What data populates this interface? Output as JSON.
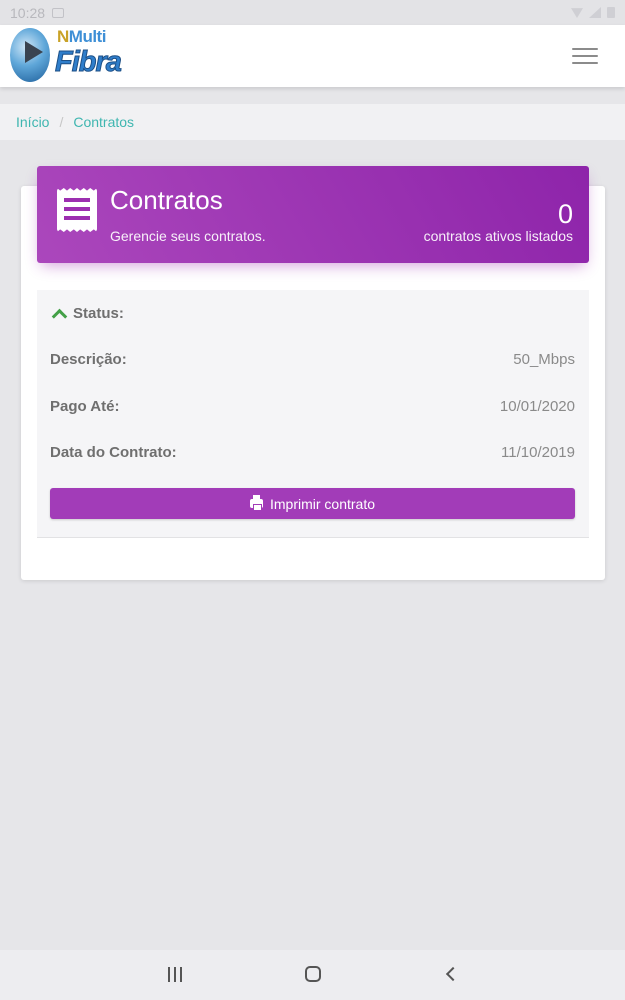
{
  "statusbar": {
    "time": "10:28"
  },
  "navbar": {
    "logo_top_a": "N",
    "logo_top_b": "Multi",
    "logo_bottom": "Fibra"
  },
  "breadcrumb": {
    "home": "Início",
    "current": "Contratos"
  },
  "header": {
    "title": "Contratos",
    "subtitle": "Gerencie seus contratos.",
    "count": "0",
    "count_label": "contratos ativos listados"
  },
  "contract": {
    "status_label": "Status:",
    "description_label": "Descrição:",
    "description_value": "50_Mbps",
    "paid_until_label": "Pago Até:",
    "paid_until_value": "10/01/2020",
    "contract_date_label": "Data do Contrato:",
    "contract_date_value": "11/10/2019",
    "print_button": "Imprimir contrato"
  },
  "colors": {
    "accent": "#9c27b0",
    "link": "#3fb6b0",
    "status_chevron": "#43a047"
  },
  "icons": {
    "menu": "hamburger-menu-icon",
    "header": "document-list-icon",
    "status": "chevron-up-icon",
    "print": "printer-icon"
  }
}
